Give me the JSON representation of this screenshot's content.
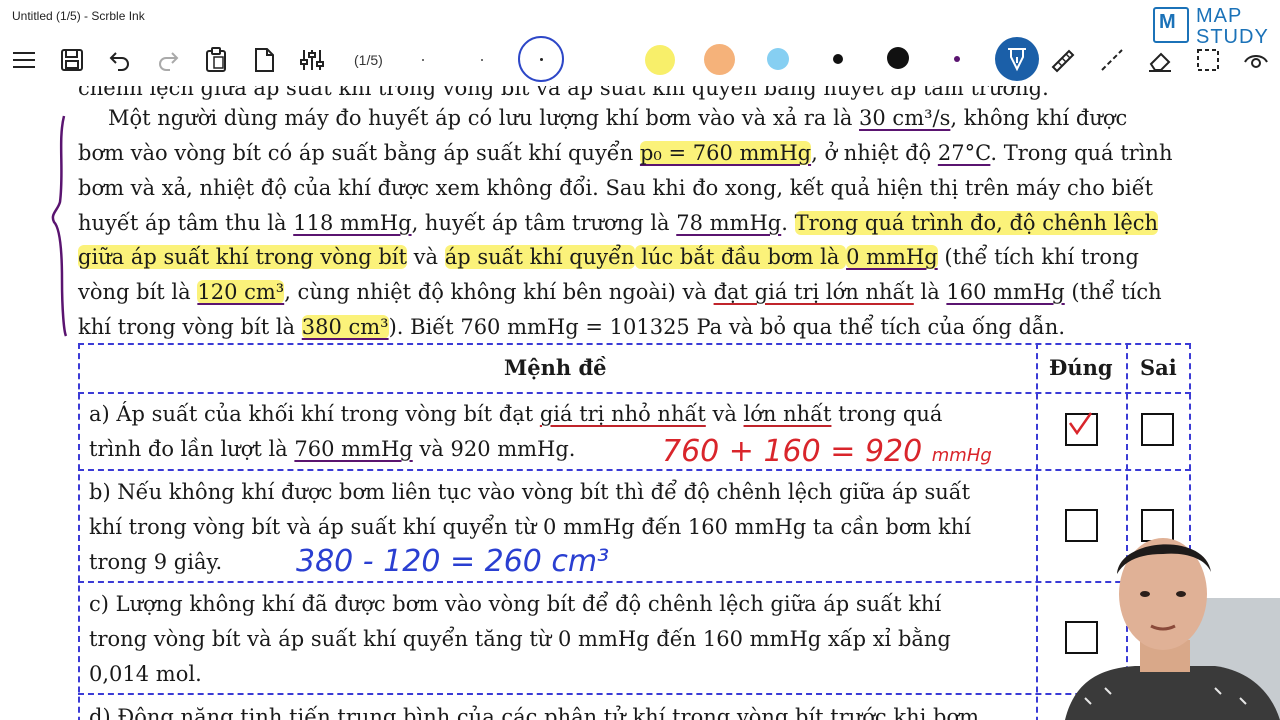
{
  "window": {
    "title": "Untitled (1/5) - Scrble Ink"
  },
  "toolbar": {
    "page_indicator": "(1/5)",
    "icons": [
      "menu-icon",
      "save-icon",
      "undo-icon",
      "redo-icon",
      "paste-icon",
      "new-page-icon",
      "settings-sliders-icon",
      "pen-icon",
      "highlighter-icon",
      "line-tool-icon",
      "eraser-icon",
      "lasso-select-icon",
      "view-icon"
    ],
    "colors": {
      "yellow": "#f8ef6a",
      "orange": "#f5b27a",
      "light_blue": "#86cff2",
      "black": "#111111",
      "purple": "#5a1470",
      "active_tool": "#1b5fa8"
    }
  },
  "logo": {
    "box_letter": "M",
    "line1": "MAP",
    "line2": "STUDY"
  },
  "document": {
    "cut_line": "chênh lệch giữa áp suất khí trong vòng bít và áp suất khí quyển bằng huyết áp tâm trương.",
    "p1": {
      "a": "Một người dùng máy đo huyết áp có lưu lượng khí bơm vào và xả ra là ",
      "b": "30 cm³/s",
      "c": ", không khí được"
    },
    "p2": {
      "a": "bơm vào vòng bít có áp suất bằng áp suất khí quyển ",
      "b": "p₀ = 760 mmHg",
      "c": ", ở nhiệt độ ",
      "d": "27°C",
      "e": ". Trong quá trình"
    },
    "p3": "bơm và xả, nhiệt độ của khí được xem không đổi. Sau khi đo xong, kết quả hiện thị trên máy cho biết",
    "p4": {
      "a": "huyết áp tâm thu là ",
      "b": "118 mmHg",
      "c": ", huyết áp tâm trương là ",
      "d": "78 mmHg",
      "e": ". ",
      "f": "Trong quá trình đo, độ chênh lệch"
    },
    "p5": {
      "a": "giữa áp suất khí trong vòng bít",
      "b": " và ",
      "c": "áp suất khí quyển",
      "d": " lúc bắt đầu bơm là ",
      "e": "0 mmHg",
      "f": " (thể tích khí trong"
    },
    "p6": {
      "a": "vòng bít là ",
      "b": "120 cm³",
      "c": ", cùng nhiệt độ không khí bên ngoài) và ",
      "d": "đạt giá trị lớn nhất",
      "e": " là ",
      "f": "160 mmHg",
      "g": " (thể tích"
    },
    "p7": {
      "a": "khí trong vòng bít là ",
      "b": "380 cm³",
      "c": "). Biết 760 mmHg = 101325 Pa và bỏ qua thể tích của ống dẫn."
    }
  },
  "table": {
    "headers": {
      "statement": "Mệnh đề",
      "true": "Đúng",
      "false": "Sai"
    },
    "rows": [
      {
        "line1_a": "a) Áp suất của khối khí trong vòng bít đạt ",
        "line1_b": "giá trị nhỏ nhất",
        "line1_c": " và ",
        "line1_d": "lớn nhất",
        "line1_e": " trong quá",
        "line2_a": "trình đo lần lượt là ",
        "line2_b": "760 mmHg",
        "line2_c": " và 920 mmHg.",
        "true_checked": true,
        "false_checked": false
      },
      {
        "line1": "b) Nếu không khí được bơm liên tục vào vòng bít thì để độ chênh lệch giữa áp suất",
        "line2": "khí trong vòng bít và áp suất khí quyển từ 0 mmHg đến 160 mmHg ta cần bơm khí",
        "line3": "trong 9 giây.",
        "true_checked": false,
        "false_checked": false
      },
      {
        "line1": "c) Lượng không khí đã được bơm vào vòng bít để độ chênh lệch giữa áp suất khí",
        "line2": "trong vòng bít và áp suất khí quyển tăng từ 0 mmHg đến 160 mmHg xấp xỉ bằng",
        "line3": "0,014 mol.",
        "true_checked": false,
        "false_checked": false
      },
      {
        "line1": "d) Động năng tịnh tiến trung bình của các phân tử khí trong vòng bít trước khi bơm"
      }
    ]
  },
  "ink": {
    "note_a": "760 + 160 = 920",
    "note_a_unit": "mmHg",
    "note_b": "380 - 120 = 260 cm³",
    "colors": {
      "red": "#d9252b",
      "blue": "#2a3fd1",
      "purple": "#5a1470"
    }
  }
}
